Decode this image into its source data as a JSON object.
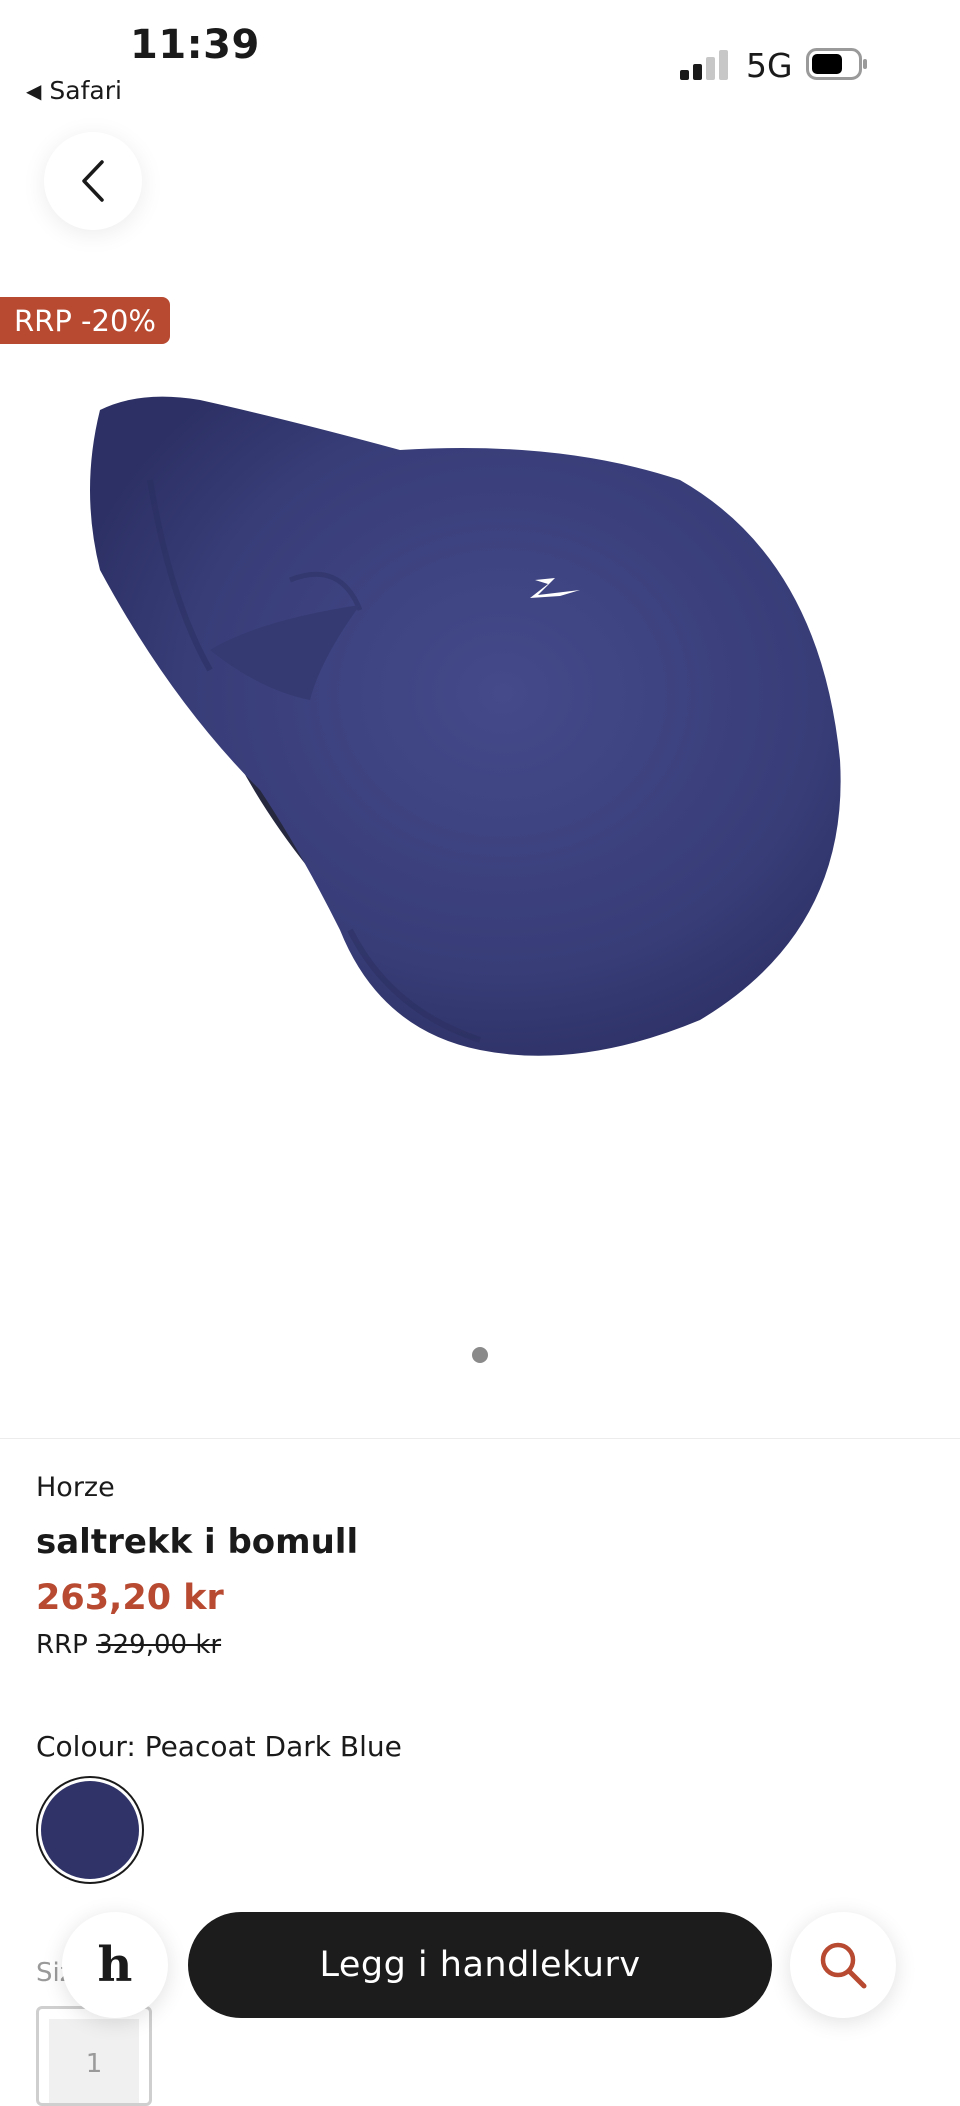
{
  "status_bar": {
    "time": "11:39",
    "back_app": "Safari",
    "network": "5G"
  },
  "product": {
    "badge": "RRP -20%",
    "brand": "Horze",
    "title": "saltrekk i bomull",
    "price": "263,20 kr",
    "rrp_prefix": "RRP",
    "rrp_price": "329,00 kr",
    "colour_label": "Colour: Peacoat Dark Blue",
    "swatch_color": "#2f3368",
    "size_label": "Size",
    "size_value": "1",
    "image_count": 1,
    "active_image": 1
  },
  "actions": {
    "logo_letter": "h",
    "add_to_cart": "Legg i handlekurv"
  },
  "icons": {
    "back": "chevron-left-icon",
    "search": "search-icon"
  },
  "colors": {
    "accent": "#b84a32",
    "cart_button": "#1c1c1c",
    "saddle": "#3a3f7a"
  }
}
